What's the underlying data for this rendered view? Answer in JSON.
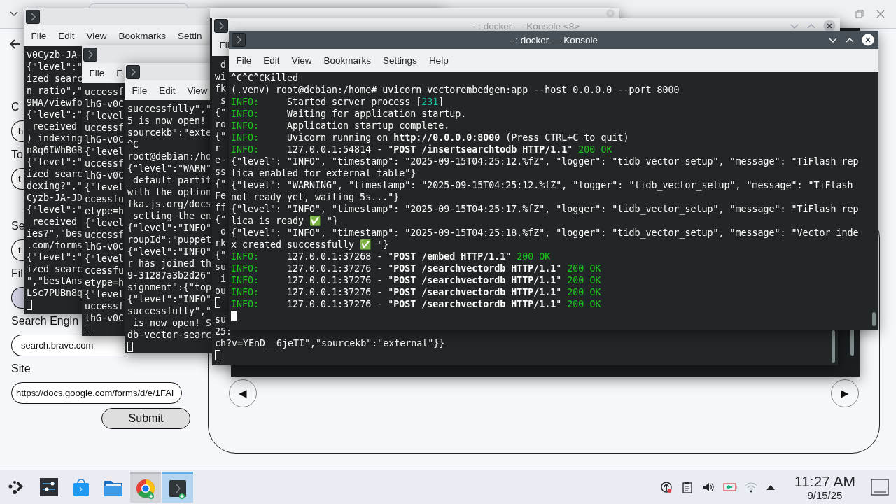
{
  "browser": {
    "form": [
      {
        "kind": "field",
        "label": "C",
        "value": "h"
      },
      {
        "kind": "field",
        "label": "To",
        "value": "t"
      },
      {
        "kind": "field",
        "label": "Se",
        "value": "t"
      },
      {
        "kind": "file",
        "label": "Fil"
      },
      {
        "kind": "field",
        "label": "Search Engin",
        "value": "search.brave.com"
      },
      {
        "kind": "field",
        "label": "Site",
        "value": "https://docs.google.com/forms/d/e/1FAI"
      }
    ],
    "submit": "Submit",
    "carousel": {
      "prev": "◀",
      "next": "▶"
    }
  },
  "back_terminals": [
    {
      "menu": [
        "File",
        "Edit",
        "View",
        "Bookmarks",
        "Settin"
      ],
      "lines": [
        "v0Cyzb-JA-",
        "{\"level\":\"",
        "ized searc",
        "n ratio\",\"",
        "9MA/viewfo",
        "{\"level\":\"",
        " received",
        ") indexing",
        "n8q6IWhBGB",
        "{\"level\":\"",
        "ized searc",
        "dexing?\",\"",
        "Cyzb-JA-JD",
        "{\"level\":\"",
        " received",
        "ies?\",\"bes",
        ".com/forms",
        "{\"level\":\"",
        "ized searc",
        "\",\"bestAns",
        "LSc7PUBn8q"
      ]
    },
    {
      "menu": [
        "File",
        "E"
      ],
      "lines": [
        "uccessf",
        "lhG-v0C",
        "{\"level",
        "uccessf",
        "lhG-v0C",
        "{\"level",
        "uccessf",
        "lhG-v0C",
        "{\"level",
        "ccessfu",
        "etype=h",
        "{\"level",
        "uccessf",
        "lhG-v0C",
        "{\"level",
        "ccessfu",
        "etype=h",
        "{\"level",
        "uccessf",
        "lhG-v0C"
      ]
    },
    {
      "menu": [
        "File",
        "Edit",
        "View"
      ],
      "lines": [
        "successfully\",\"",
        "5 is now open!",
        "sourcekb\":\"exte",
        "^C",
        "root@debian:/ho",
        "{\"level\":\"WARN\"",
        " default partit",
        "with the option",
        "fka.js.org/docs",
        " setting the en",
        "{\"level\":\"INFO\"",
        "roupId\":\"puppet",
        "{\"level\":\"INFO\"",
        "r has joined th",
        "9-31287a3b2d26\"",
        "signment\":{\"top",
        "{\"level\":\"INFO\"",
        "successfully\",\"",
        " is now open! S",
        "db-vector-searc"
      ]
    },
    {
      "title": "- : docker — Konsole <8>",
      "menu": [
        "Fil"
      ],
      "lines": [
        " d",
        "wi",
        "fk",
        " s",
        "{\"",
        "ro",
        "{\"",
        "r",
        "e-",
        "ss",
        "{\"",
        "Fe",
        "ff",
        "{\"",
        " o",
        "rk",
        "{\"",
        "su",
        " i",
        "ou"
      ]
    },
    {
      "lines": [
        "su",
        "25:",
        "ch?v=YEnD__6jeTI\",\"sourcekb\":\"external\"}}"
      ]
    }
  ],
  "front_terminal": {
    "title": "- : docker — Konsole",
    "menu": [
      "File",
      "Edit",
      "View",
      "Bookmarks",
      "Settings",
      "Help"
    ],
    "lines": [
      [
        {
          "kind": "plain",
          "text": "^C^C^CKilled"
        }
      ],
      [
        {
          "kind": "plain",
          "text": "(.venv) root@debian:/home# uvicorn vectorembedgen:app --host 0.0.0.0 --port 8000"
        }
      ],
      [
        {
          "kind": "info",
          "text": "INFO:"
        },
        {
          "kind": "plain",
          "text": "     Started server process ["
        },
        {
          "kind": "num",
          "text": "231"
        },
        {
          "kind": "plain",
          "text": "]"
        }
      ],
      [
        {
          "kind": "info",
          "text": "INFO:"
        },
        {
          "kind": "plain",
          "text": "     Waiting for application startup."
        }
      ],
      [
        {
          "kind": "info",
          "text": "INFO:"
        },
        {
          "kind": "plain",
          "text": "     Application startup complete."
        }
      ],
      [
        {
          "kind": "info",
          "text": "INFO:"
        },
        {
          "kind": "plain",
          "text": "     Uvicorn running on "
        },
        {
          "kind": "bold",
          "text": "http://0.0.0.0:8000"
        },
        {
          "kind": "plain",
          "text": " (Press CTRL+C to quit)"
        }
      ],
      [
        {
          "kind": "info",
          "text": "INFO:"
        },
        {
          "kind": "plain",
          "text": "     127.0.0.1:54814 - \""
        },
        {
          "kind": "bold",
          "text": "POST /insertsearchtodb HTTP/1.1"
        },
        {
          "kind": "plain",
          "text": "\" "
        },
        {
          "kind": "ok",
          "text": "200 OK"
        }
      ],
      [
        {
          "kind": "plain",
          "text": "{\"level\": \"INFO\", \"timestamp\": \"2025-09-15T04:25:12.%fZ\", \"logger\": \"tidb_vector_setup\", \"message\": \"TiFlash rep"
        }
      ],
      [
        {
          "kind": "plain",
          "text": "lica enabled for external table\"}"
        }
      ],
      [
        {
          "kind": "plain",
          "text": "{\"level\": \"WARNING\", \"timestamp\": \"2025-09-15T04:25:12.%fZ\", \"logger\": \"tidb_vector_setup\", \"message\": \"TiFlash"
        }
      ],
      [
        {
          "kind": "plain",
          "text": "not ready yet, waiting 5s...\"}"
        }
      ],
      [
        {
          "kind": "plain",
          "text": "{\"level\": \"INFO\", \"timestamp\": \"2025-09-15T04:25:17.%fZ\", \"logger\": \"tidb_vector_setup\", \"message\": \"TiFlash rep"
        }
      ],
      [
        {
          "kind": "plain",
          "text": "lica is ready ✅ \"}"
        }
      ],
      [
        {
          "kind": "plain",
          "text": "{\"level\": \"INFO\", \"timestamp\": \"2025-09-15T04:25:18.%fZ\", \"logger\": \"tidb_vector_setup\", \"message\": \"Vector inde"
        }
      ],
      [
        {
          "kind": "plain",
          "text": "x created successfully ✅ \"}"
        }
      ],
      [
        {
          "kind": "info",
          "text": "INFO:"
        },
        {
          "kind": "plain",
          "text": "     127.0.0.1:37268 - \""
        },
        {
          "kind": "bold",
          "text": "POST /embed HTTP/1.1"
        },
        {
          "kind": "plain",
          "text": "\" "
        },
        {
          "kind": "ok",
          "text": "200 OK"
        }
      ],
      [
        {
          "kind": "info",
          "text": "INFO:"
        },
        {
          "kind": "plain",
          "text": "     127.0.0.1:37276 - \""
        },
        {
          "kind": "bold",
          "text": "POST /searchvectordb HTTP/1.1"
        },
        {
          "kind": "plain",
          "text": "\" "
        },
        {
          "kind": "ok",
          "text": "200 OK"
        }
      ],
      [
        {
          "kind": "info",
          "text": "INFO:"
        },
        {
          "kind": "plain",
          "text": "     127.0.0.1:37276 - \""
        },
        {
          "kind": "bold",
          "text": "POST /searchvectordb HTTP/1.1"
        },
        {
          "kind": "plain",
          "text": "\" "
        },
        {
          "kind": "ok",
          "text": "200 OK"
        }
      ],
      [
        {
          "kind": "info",
          "text": "INFO:"
        },
        {
          "kind": "plain",
          "text": "     127.0.0.1:37276 - \""
        },
        {
          "kind": "bold",
          "text": "POST /searchvectordb HTTP/1.1"
        },
        {
          "kind": "plain",
          "text": "\" "
        },
        {
          "kind": "ok",
          "text": "200 OK"
        }
      ],
      [
        {
          "kind": "info",
          "text": "INFO:"
        },
        {
          "kind": "plain",
          "text": "     127.0.0.1:37276 - \""
        },
        {
          "kind": "bold",
          "text": "POST /searchvectordb HTTP/1.1"
        },
        {
          "kind": "plain",
          "text": "\" "
        },
        {
          "kind": "ok",
          "text": "200 OK"
        }
      ]
    ]
  },
  "taskbar": {
    "tasks": [
      {
        "kind": "launcher",
        "selected": false,
        "hovered": false
      },
      {
        "kind": "settings",
        "selected": false,
        "hovered": false
      },
      {
        "kind": "store",
        "selected": false,
        "hovered": false
      },
      {
        "kind": "files",
        "selected": false,
        "hovered": false
      },
      {
        "kind": "browser",
        "selected": false,
        "hovered": true
      },
      {
        "kind": "terminal",
        "selected": true,
        "hovered": false
      }
    ],
    "clock": {
      "time": "11:27 AM",
      "date": "9/15/25"
    }
  }
}
